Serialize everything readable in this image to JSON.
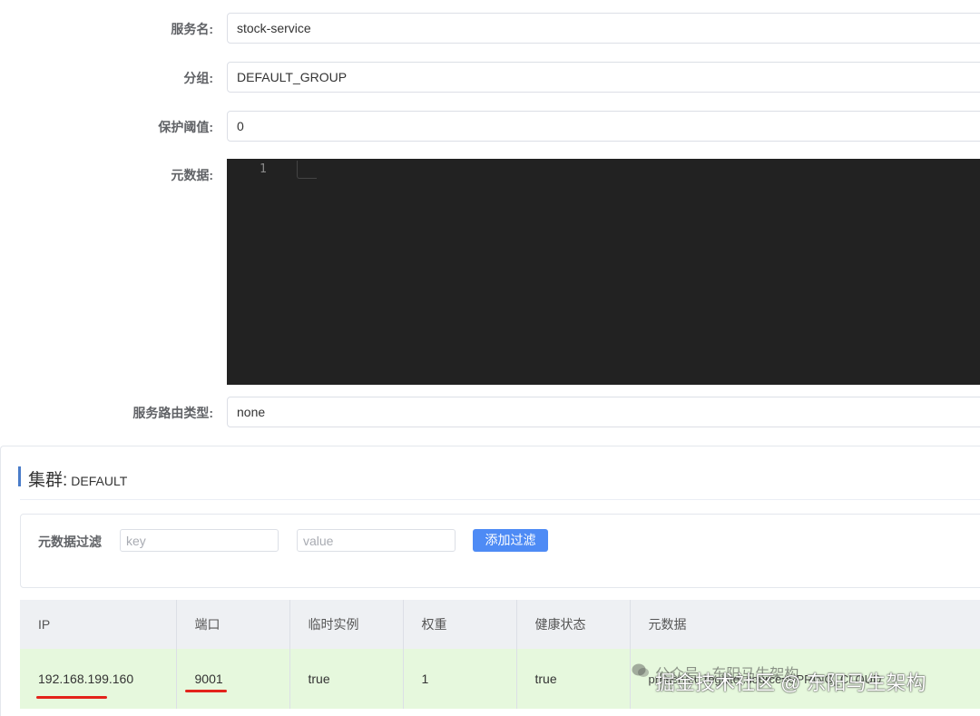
{
  "form": {
    "service_name": {
      "label": "服务名:",
      "value": "stock-service"
    },
    "group": {
      "label": "分组:",
      "value": "DEFAULT_GROUP"
    },
    "protect_threshold": {
      "label": "保护阈值:",
      "value": "0"
    },
    "metadata": {
      "label": "元数据:",
      "line_number": "1"
    },
    "route_type": {
      "label": "服务路由类型:",
      "value": "none"
    }
  },
  "cluster": {
    "label": "集群:",
    "name": "DEFAULT",
    "filter": {
      "label": "元数据过滤",
      "key_placeholder": "key",
      "value_placeholder": "value",
      "add_button": "添加过滤"
    },
    "columns": [
      "IP",
      "端口",
      "临时实例",
      "权重",
      "健康状态",
      "元数据"
    ],
    "rows": [
      {
        "ip": "192.168.199.160",
        "port": "9001",
        "ephemeral": "true",
        "weight": "1",
        "healthy": "true",
        "metadata": "preserved.register.source=SPRING_CLOUD"
      }
    ]
  },
  "watermark": {
    "top": "公众号 · 东阳马生架构",
    "main": "掘金技术社区 @ 东阳马生架构"
  },
  "colors": {
    "accent": "#4e8bf5",
    "row_bg": "#e6f8dd",
    "highlight_underline": "#e3231b",
    "editor_bg": "#222222"
  }
}
